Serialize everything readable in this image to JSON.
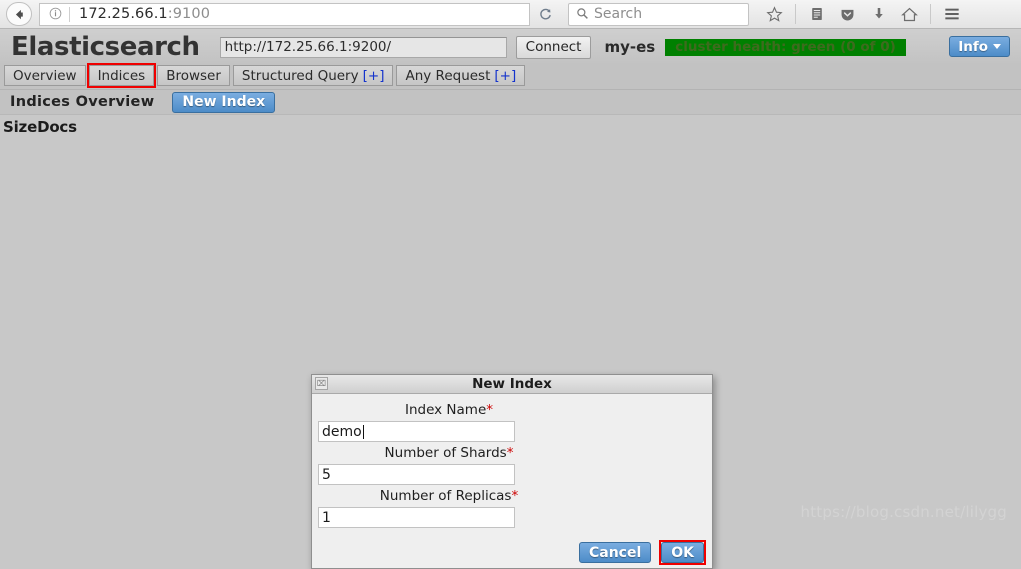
{
  "browser": {
    "back_icon": "back-arrow-icon",
    "info_icon": "info-circle-icon",
    "url_host": "172.25.66.1",
    "url_port": ":9100",
    "reload_icon": "reload-icon",
    "search_icon": "search-icon",
    "search_placeholder": "Search",
    "toolbar_icons": [
      {
        "name": "bookmark-star-icon",
        "glyph": "☆"
      },
      {
        "name": "library-icon",
        "glyph": "▤"
      },
      {
        "name": "pocket-icon",
        "glyph": "▼"
      },
      {
        "name": "downloads-icon",
        "glyph": "⬇"
      },
      {
        "name": "home-icon",
        "glyph": "⌂"
      },
      {
        "name": "menu-hamburger-icon",
        "glyph": "≡"
      }
    ]
  },
  "app": {
    "brand": "Elasticsearch",
    "host_value": "http://172.25.66.1:9200/",
    "connect_label": "Connect",
    "cluster_name": "my-es",
    "cluster_health": "cluster health: green (0 of 0)",
    "cluster_health_color": "#008000",
    "info_label": "Info",
    "tabs": [
      {
        "label": "Overview",
        "plus": "",
        "highlighted": false
      },
      {
        "label": "Indices",
        "plus": "",
        "highlighted": true
      },
      {
        "label": "Browser",
        "plus": "",
        "highlighted": false
      },
      {
        "label": "Structured Query",
        "plus": "[+]",
        "highlighted": false
      },
      {
        "label": "Any Request",
        "plus": "[+]",
        "highlighted": false
      }
    ],
    "subtitle": "Indices Overview",
    "new_index_label": "New Index",
    "columns": [
      "Size",
      "Docs"
    ],
    "watermark": "https://blog.csdn.net/lilygg"
  },
  "modal": {
    "title": "New Index",
    "close_glyph": "⌧",
    "fields": [
      {
        "label": "Index Name",
        "required": "*",
        "value": "demo",
        "has_caret": true
      },
      {
        "label": "Number of Shards",
        "required": "*",
        "value": "5",
        "has_caret": false
      },
      {
        "label": "Number of Replicas",
        "required": "*",
        "value": "1",
        "has_caret": false
      }
    ],
    "cancel_label": "Cancel",
    "ok_label": "OK"
  }
}
